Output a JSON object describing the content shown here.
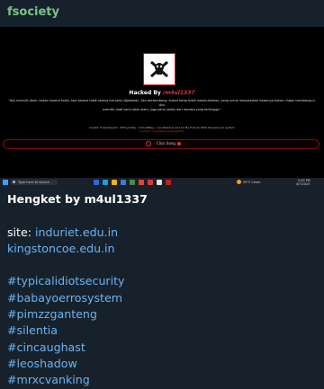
{
  "chat": {
    "channel_name": "fsociety"
  },
  "screenshot": {
    "logo_alt": "skull-emblem",
    "hacked_prefix": "Hacked By",
    "hacked_name": "/m4ul1337",
    "message_line1": "\"Aku memilih diam, bukan karena kalah, tapi karena tidak semua hal perlu dijelaskan. Aku berkembang, bukan tetap tidak membutuhkan, yang untuk menjelaskan bawanya bukan ringan membangun. Aku",
    "message_line2": "memilih mati kami diam diam, juga perlu selalu dari mereka yang terhingga.\"",
    "greets_line1": "Greetz: FlowerSquad - MrPuyanNg - IndoxaBtiey - LeonShadow and All My Friends WKG Tampak pull system",
    "greets_line2": "Contact: t.me/wibungLahag1337",
    "player_label": "Click Song",
    "taskbar": {
      "search_placeholder": "Type here to search",
      "weather": "29°C Cerah",
      "time": "5:45 PM",
      "date": "4/7/2025"
    }
  },
  "message": {
    "title": "Hengket by m4ul1337",
    "site_label": "site:",
    "sites": [
      "induriet.edu.in",
      "kingstoncoe.edu.in"
    ],
    "hashtags": [
      "#typicalidiotsecurity",
      "#babayoerrosystem",
      "#pimzzganteng",
      "#silentia",
      "#cincaughast",
      "#leoshadow",
      "#mrxcvanking"
    ]
  },
  "colors": {
    "background": "#17212b",
    "channel_name": "#78c487",
    "link": "#6ab3f3",
    "accent_red": "#e23232"
  }
}
